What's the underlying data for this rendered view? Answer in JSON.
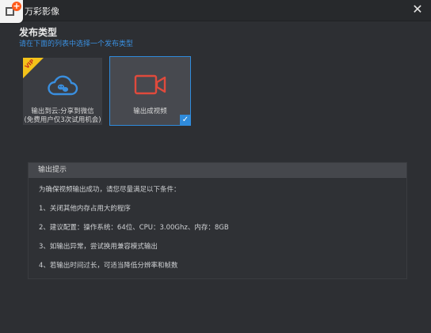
{
  "window": {
    "title": "万彩影像",
    "close_label": "✕"
  },
  "publish": {
    "title": "发布类型",
    "hint": "请在下面的列表中选择一个发布类型"
  },
  "options": [
    {
      "line1": "输出到云:分享到微信",
      "line2": "(免费用户仅3次试用机会)",
      "badge": "VIP",
      "icon": "cloud-share-icon",
      "accent": "#3a8fdf"
    },
    {
      "line1": "输出成视频",
      "icon": "video-camera-icon",
      "accent": "#e04a3c",
      "selected_mark": "✓"
    }
  ],
  "tips": {
    "header": "输出提示",
    "intro": "为确保视频输出成功，请您尽量满足以下条件：",
    "items": [
      "1、关闭其他内存占用大的程序",
      "2、建议配置：操作系统：64位、CPU：3.00Ghz、内存：8GB",
      "3、如输出异常，尝试换用兼容模式输出",
      "4、若输出时间过长，可适当降低分辨率和帧数"
    ]
  },
  "colors": {
    "background": "#2d2f33",
    "selection": "#2f8bdc",
    "vip": "#f3c21a"
  }
}
